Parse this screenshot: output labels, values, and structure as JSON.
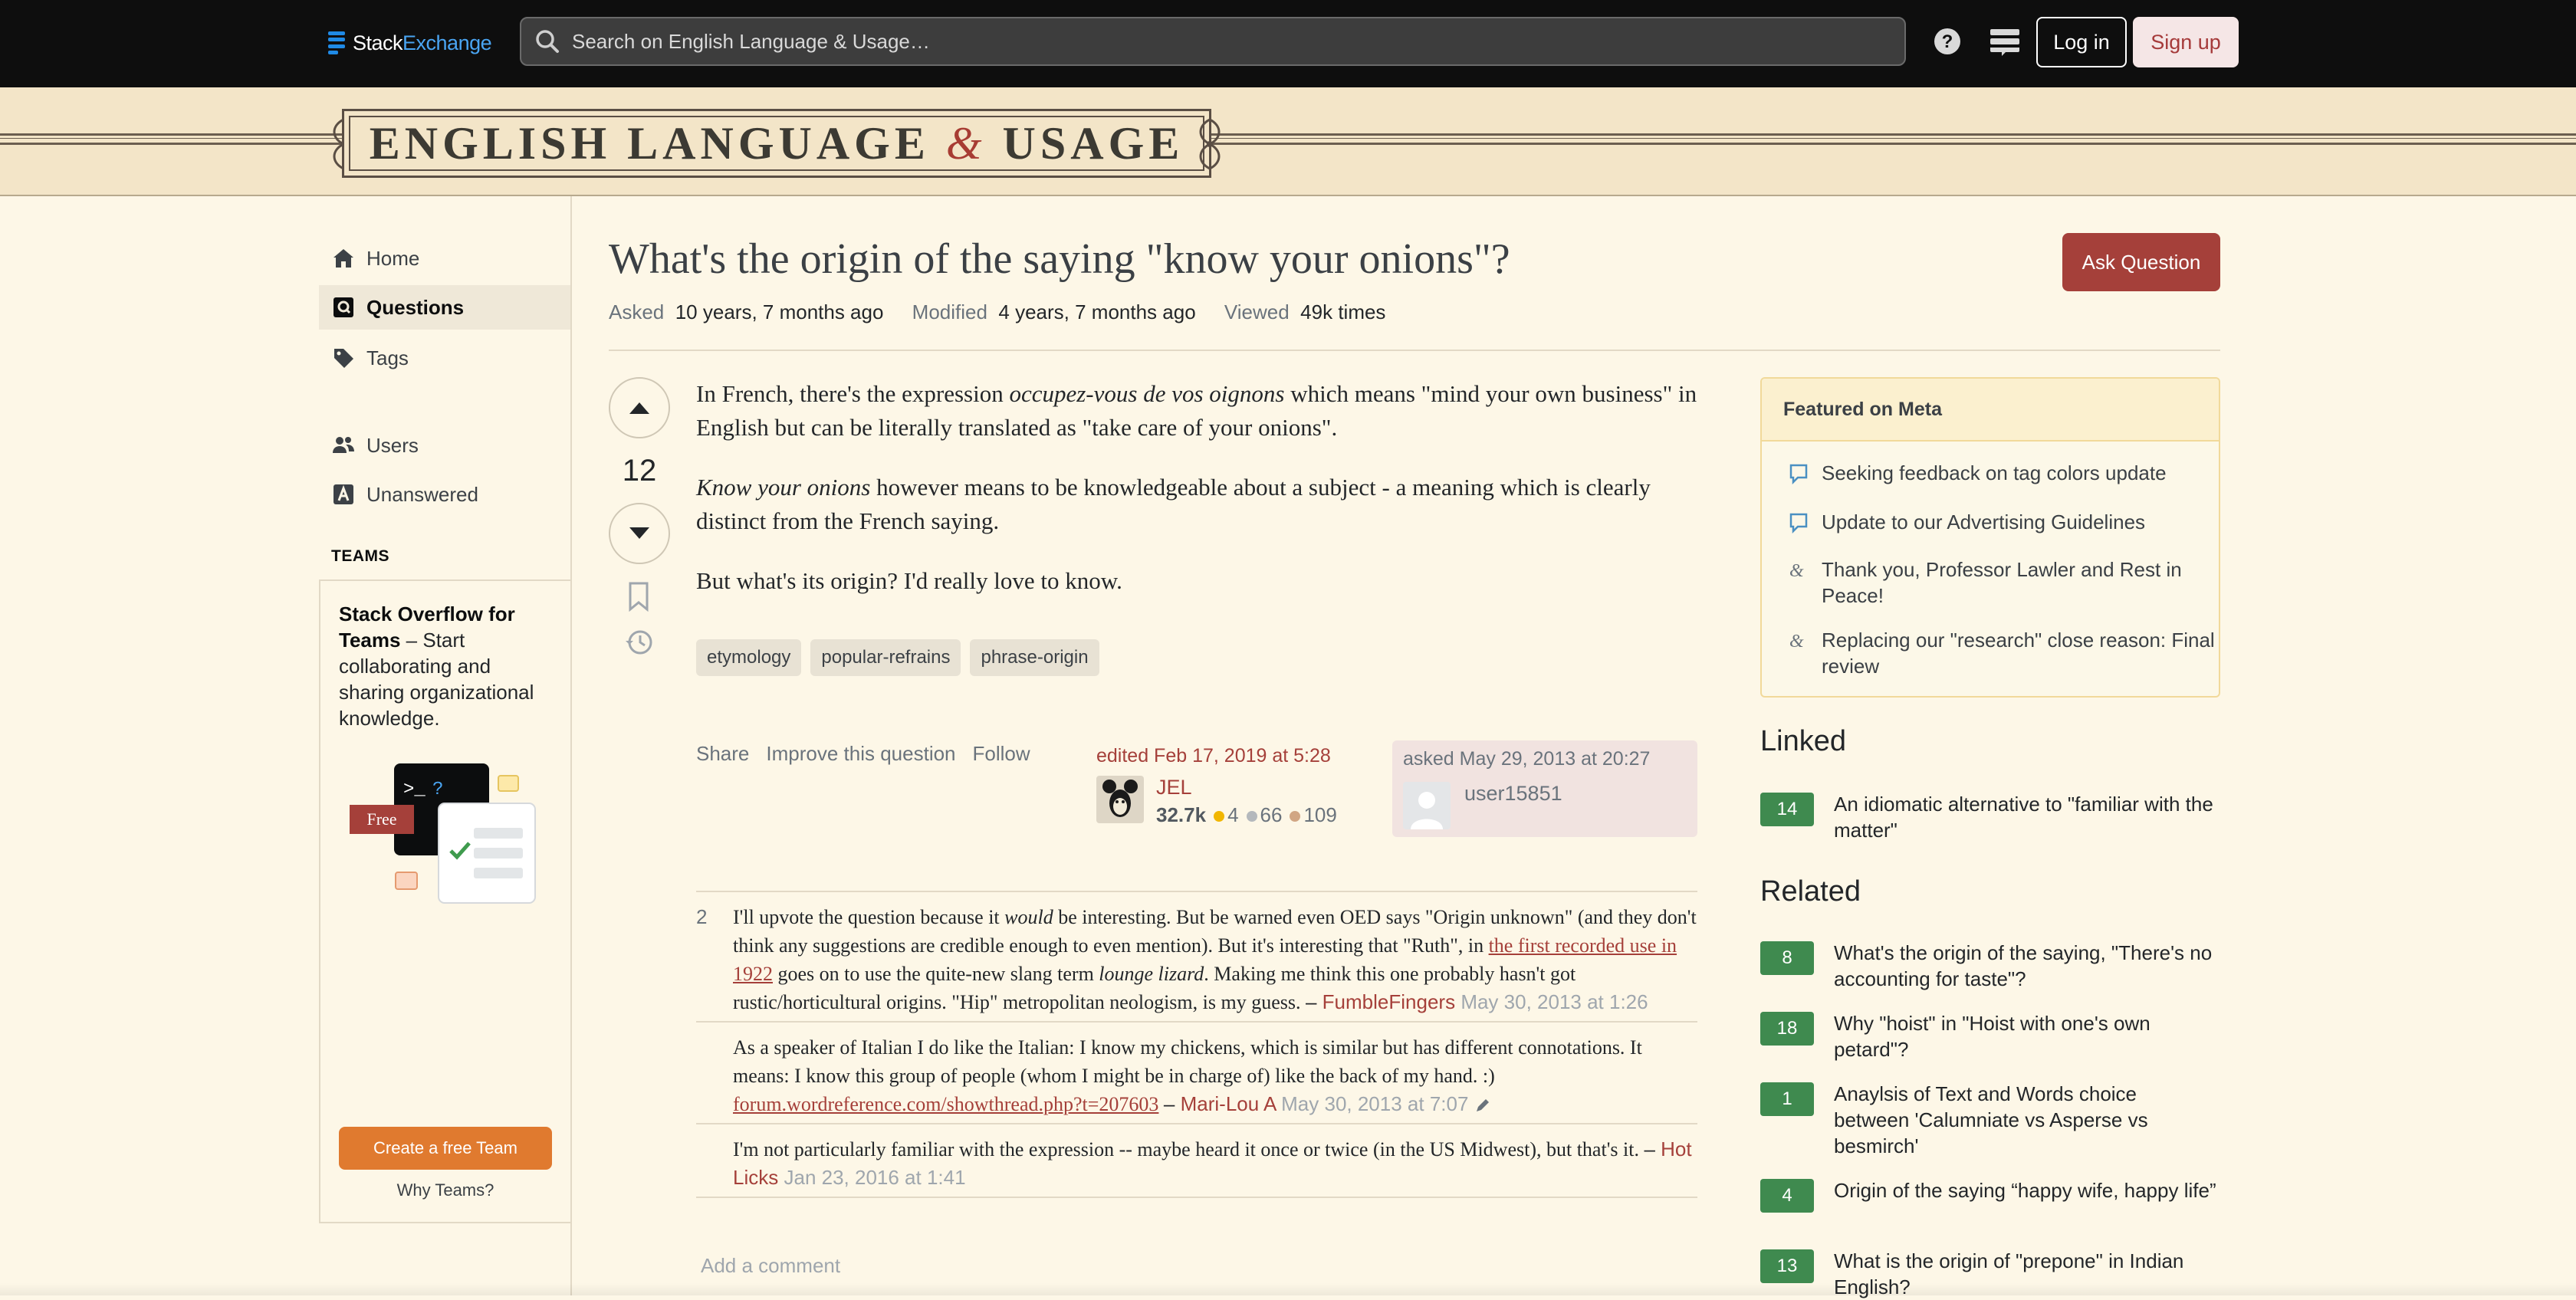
{
  "header": {
    "logo_prefix": "Stack",
    "logo_suffix": "Exchange",
    "search_placeholder": "Search on English Language & Usage…",
    "login_label": "Log in",
    "signup_label": "Sign up"
  },
  "banner": {
    "title_left": "ENGLISH LANGUAGE",
    "title_amp": "&",
    "title_right": "USAGE"
  },
  "nav": {
    "home": "Home",
    "questions": "Questions",
    "tags": "Tags",
    "users": "Users",
    "unanswered": "Unanswered",
    "teams_heading": "TEAMS",
    "teams_title": "Stack Overflow for Teams",
    "teams_desc": " – Start collaborating and sharing organizational knowledge.",
    "free_badge": "Free",
    "create_team": "Create a free Team",
    "why_teams": "Why Teams?"
  },
  "question": {
    "title": "What's the origin of the saying \"know your onions\"?",
    "ask_button": "Ask Question",
    "asked_label": "Asked",
    "asked_value": "10 years, 7 months ago",
    "modified_label": "Modified",
    "modified_value": "4 years, 7 months ago",
    "viewed_label": "Viewed",
    "viewed_value": "49k times",
    "votes": "12",
    "p1_a": "In French, there's the expression ",
    "p1_em": "occupez-vous de vos oignons",
    "p1_b": " which means \"mind your own business\" in English but can be literally translated as \"take care of your onions\".",
    "p2_em": "Know your onions",
    "p2_b": " however means to be knowledgeable about a subject - a meaning which is clearly distinct from the French saying.",
    "p3": "But what's its origin? I'd really love to know.",
    "tags": [
      "etymology",
      "popular-refrains",
      "phrase-origin"
    ],
    "share": "Share",
    "improve": "Improve this question",
    "follow": "Follow",
    "edited_when": "edited Feb 17, 2019 at 5:28",
    "editor_name": "JEL",
    "editor_rep": "32.7k",
    "editor_gold": "4",
    "editor_silver": "66",
    "editor_bronze": "109",
    "asked_when": "asked May 29, 2013 at 20:27",
    "asker_name": "user15851"
  },
  "comments": [
    {
      "score": "2",
      "text_a": "I'll upvote the question because it ",
      "text_em": "would",
      "text_b": " be interesting. But be warned even OED says \"Origin unknown\" (and they don't think any suggestions are credible enough to even mention). But it's interesting that \"Ruth\", in ",
      "link": "the first recorded use in 1922",
      "text_c": " goes on to use the quite-new slang term ",
      "text_em2": "lounge lizard",
      "text_d": ". Making me think this one probably hasn't got rustic/horticultural origins. \"Hip\" metropolitan neologism, is my guess.",
      "author": "FumbleFingers",
      "date": "May 30, 2013 at 1:26"
    },
    {
      "score": "",
      "text_a": "As a speaker of Italian I do like the Italian: I know my chickens, which is similar but has different connotations. It means: I know this group of people (whom I might be in charge of) like the back of my hand. :) ",
      "link": "forum.wordreference.com/showthread.php?t=207603",
      "author": "Mari-Lou A",
      "date": "May 30, 2013 at 7:07"
    },
    {
      "score": "",
      "text_a": "I'm not particularly familiar with the expression -- maybe heard it once or twice (in the US Midwest), but that's it.",
      "author": "Hot Licks",
      "date": "Jan 23, 2016 at 1:41"
    }
  ],
  "add_comment": "Add a comment",
  "sidebar": {
    "meta_heading": "Featured on Meta",
    "meta_items": [
      "Seeking feedback on tag colors update",
      "Update to our Advertising Guidelines",
      "Thank you, Professor Lawler and Rest in Peace!",
      "Replacing our \"research\" close reason: Final review"
    ],
    "linked_heading": "Linked",
    "linked": [
      {
        "score": "14",
        "title": "An idiomatic alternative to \"familiar with the matter\""
      }
    ],
    "related_heading": "Related",
    "related": [
      {
        "score": "8",
        "title": "What's the origin of the saying, \"There's no accounting for taste\"?"
      },
      {
        "score": "18",
        "title": "Why \"hoist\" in \"Hoist with one's own petard\"?"
      },
      {
        "score": "1",
        "title": "Anaylsis of Text and Words choice between 'Calumniate vs Asperse vs besmirch'"
      },
      {
        "score": "4",
        "title": "Origin of the saying “happy wife, happy life”"
      },
      {
        "score": "13",
        "title": "What is the origin of \"prepone\" in Indian English?"
      }
    ]
  },
  "colors": {
    "accent_red": "#a5403a",
    "topbar": "#0e0e0e",
    "page_bg": "#fdf7e7",
    "banner_bg": "#f3e5c8",
    "score_green": "#3f8a4f",
    "team_orange": "#e07a2f"
  }
}
